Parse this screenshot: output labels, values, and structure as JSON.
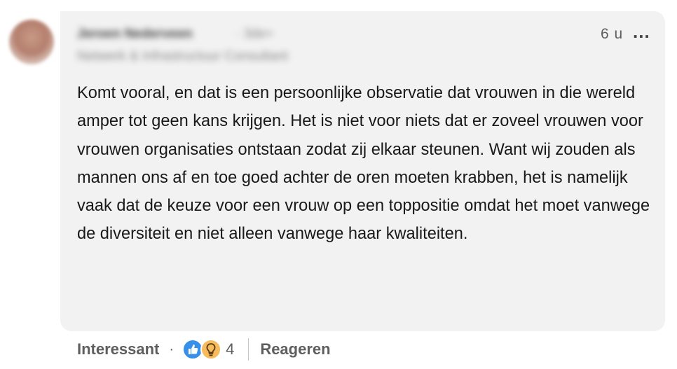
{
  "comment": {
    "author": {
      "name": "Jeroen Nederveen",
      "degree": "· 3de+",
      "headline": "Netwerk & Infrastructuur Consultant"
    },
    "timestamp": "6 u",
    "more_label": "...",
    "text": "Komt vooral, en dat is een persoonlijke observatie dat vrouwen in die wereld amper tot geen kans krijgen. Het is niet voor niets dat er zoveel vrouwen voor vrouwen organisaties ontstaan zodat zij elkaar steunen. Want wij zouden als mannen ons af en toe goed achter de oren moeten krabben, het is namelijk vaak dat de keuze voor een vrouw op een toppositie omdat het moet vanwege de diversiteit en niet alleen vanwege haar kwaliteiten."
  },
  "actions": {
    "like_label": "Interessant",
    "separator": "·",
    "reactions": [
      {
        "icon": "like-icon",
        "color": "#378fe9"
      },
      {
        "icon": "insightful-icon",
        "color": "#f5bb5c"
      }
    ],
    "reaction_count": "4",
    "reply_label": "Reageren"
  }
}
